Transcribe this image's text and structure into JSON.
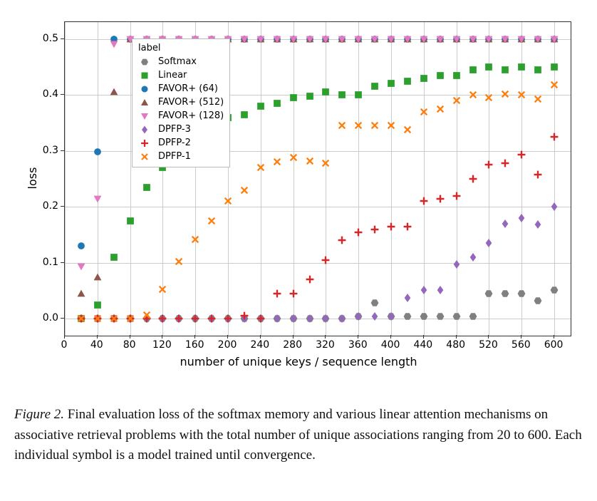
{
  "chart_data": {
    "type": "scatter",
    "xlabel": "number of unique keys / sequence length",
    "ylabel": "loss",
    "xlim": [
      0,
      620
    ],
    "ylim": [
      -0.03,
      0.53
    ],
    "xticks": [
      0,
      40,
      80,
      120,
      160,
      200,
      240,
      280,
      320,
      360,
      400,
      440,
      480,
      520,
      560,
      600
    ],
    "yticks": [
      0.0,
      0.1,
      0.2,
      0.3,
      0.4,
      0.5
    ],
    "legend_title": "label",
    "series": [
      {
        "name": "Softmax",
        "color": "#808080",
        "marker": "hex",
        "x": [
          20,
          40,
          60,
          80,
          100,
          120,
          140,
          160,
          180,
          200,
          220,
          240,
          260,
          280,
          300,
          320,
          340,
          360,
          380,
          400,
          420,
          440,
          460,
          480,
          500,
          520,
          540,
          560,
          580,
          600
        ],
        "y": [
          0,
          0,
          0,
          0,
          0,
          0,
          0,
          0,
          0,
          0,
          0,
          0,
          0,
          0,
          0,
          0,
          0,
          0.005,
          0.028,
          0.005,
          0.005,
          0.005,
          0.005,
          0.005,
          0.005,
          0.045,
          0.045,
          0.045,
          0.032,
          0.052
        ]
      },
      {
        "name": "Linear",
        "color": "#2ca02c",
        "marker": "square",
        "x": [
          20,
          40,
          60,
          80,
          100,
          120,
          140,
          160,
          180,
          200,
          220,
          240,
          260,
          280,
          300,
          320,
          340,
          360,
          380,
          400,
          420,
          440,
          460,
          480,
          500,
          520,
          540,
          560,
          580,
          600
        ],
        "y": [
          0,
          0.025,
          0.11,
          0.175,
          0.235,
          0.27,
          0.3,
          0.32,
          0.335,
          0.36,
          0.365,
          0.38,
          0.385,
          0.395,
          0.398,
          0.405,
          0.4,
          0.4,
          0.415,
          0.42,
          0.425,
          0.43,
          0.435,
          0.435,
          0.445,
          0.45,
          0.445,
          0.45,
          0.445,
          0.45
        ]
      },
      {
        "name": "FAVOR+ (64)",
        "color": "#1f77b4",
        "marker": "circle",
        "x": [
          20,
          40,
          60,
          80,
          100,
          120,
          140,
          160,
          180,
          200,
          220,
          240,
          260,
          280,
          300,
          320,
          340,
          360,
          380,
          400,
          420,
          440,
          460,
          480,
          500,
          520,
          540,
          560,
          580,
          600
        ],
        "y": [
          0.13,
          0.298,
          0.5,
          0.5,
          0.5,
          0.5,
          0.5,
          0.5,
          0.5,
          0.5,
          0.5,
          0.5,
          0.5,
          0.5,
          0.5,
          0.5,
          0.5,
          0.5,
          0.5,
          0.5,
          0.5,
          0.5,
          0.5,
          0.5,
          0.5,
          0.5,
          0.5,
          0.5,
          0.5,
          0.5
        ]
      },
      {
        "name": "FAVOR+ (512)",
        "color": "#8c564b",
        "marker": "triangle",
        "x": [
          20,
          40,
          60,
          80,
          100,
          120,
          140,
          160,
          180,
          200,
          220,
          240,
          260,
          280,
          300,
          320,
          340,
          360,
          380,
          400,
          420,
          440,
          460,
          480,
          500,
          520,
          540,
          560,
          580,
          600
        ],
        "y": [
          0.045,
          0.075,
          0.405,
          0.5,
          0.5,
          0.5,
          0.5,
          0.5,
          0.5,
          0.5,
          0.5,
          0.5,
          0.5,
          0.5,
          0.5,
          0.5,
          0.5,
          0.5,
          0.5,
          0.5,
          0.5,
          0.5,
          0.5,
          0.5,
          0.5,
          0.5,
          0.5,
          0.5,
          0.5,
          0.5
        ]
      },
      {
        "name": "FAVOR+ (128)",
        "color": "#e377c2",
        "marker": "tridown",
        "x": [
          20,
          40,
          60,
          80,
          100,
          120,
          140,
          160,
          180,
          200,
          220,
          240,
          260,
          280,
          300,
          320,
          340,
          360,
          380,
          400,
          420,
          440,
          460,
          480,
          500,
          520,
          540,
          560,
          580,
          600
        ],
        "y": [
          0.093,
          0.215,
          0.49,
          0.5,
          0.5,
          0.5,
          0.5,
          0.5,
          0.5,
          0.5,
          0.5,
          0.5,
          0.5,
          0.5,
          0.5,
          0.5,
          0.5,
          0.5,
          0.5,
          0.5,
          0.5,
          0.5,
          0.5,
          0.5,
          0.5,
          0.5,
          0.5,
          0.5,
          0.5,
          0.5
        ]
      },
      {
        "name": "DPFP-3",
        "color": "#9467bd",
        "marker": "diamond",
        "x": [
          20,
          40,
          60,
          80,
          100,
          120,
          140,
          160,
          180,
          200,
          220,
          240,
          260,
          280,
          300,
          320,
          340,
          360,
          380,
          400,
          420,
          440,
          460,
          480,
          500,
          520,
          540,
          560,
          580,
          600
        ],
        "y": [
          0,
          0,
          0,
          0,
          0,
          0,
          0,
          0,
          0,
          0,
          0,
          0,
          0,
          0,
          0,
          0,
          0,
          0.005,
          0.005,
          0.005,
          0.038,
          0.052,
          0.052,
          0.097,
          0.11,
          0.135,
          0.17,
          0.18,
          0.168,
          0.2
        ]
      },
      {
        "name": "DPFP-2",
        "color": "#d62728",
        "marker": "plus",
        "x": [
          20,
          40,
          60,
          80,
          100,
          120,
          140,
          160,
          180,
          200,
          220,
          240,
          260,
          280,
          300,
          320,
          340,
          360,
          380,
          400,
          420,
          440,
          460,
          480,
          500,
          520,
          540,
          560,
          580,
          600
        ],
        "y": [
          0,
          0,
          0,
          0,
          0,
          0,
          0,
          0,
          0,
          0,
          0.006,
          0,
          0.045,
          0.045,
          0.07,
          0.105,
          0.14,
          0.155,
          0.16,
          0.165,
          0.165,
          0.21,
          0.215,
          0.22,
          0.25,
          0.276,
          0.278,
          0.293,
          0.258,
          0.325
        ]
      },
      {
        "name": "DPFP-1",
        "color": "#ff7f0e",
        "marker": "x",
        "x": [
          20,
          40,
          60,
          80,
          100,
          120,
          140,
          160,
          180,
          200,
          220,
          240,
          260,
          280,
          300,
          320,
          340,
          360,
          380,
          400,
          420,
          440,
          460,
          480,
          500,
          520,
          540,
          560,
          580,
          600
        ],
        "y": [
          0,
          0,
          0,
          0,
          0.007,
          0.053,
          0.102,
          0.142,
          0.175,
          0.21,
          0.23,
          0.27,
          0.28,
          0.288,
          0.282,
          0.278,
          0.345,
          0.345,
          0.345,
          0.346,
          0.338,
          0.37,
          0.375,
          0.39,
          0.4,
          0.395,
          0.402,
          0.4,
          0.393,
          0.418
        ]
      }
    ]
  },
  "caption": {
    "fignum": "Figure 2.",
    "text": " Final evaluation loss of the softmax memory and various linear attention mechanisms on associative retrieval problems with the total number of unique associations ranging from 20 to 600. Each individual symbol is a model trained until convergence."
  }
}
